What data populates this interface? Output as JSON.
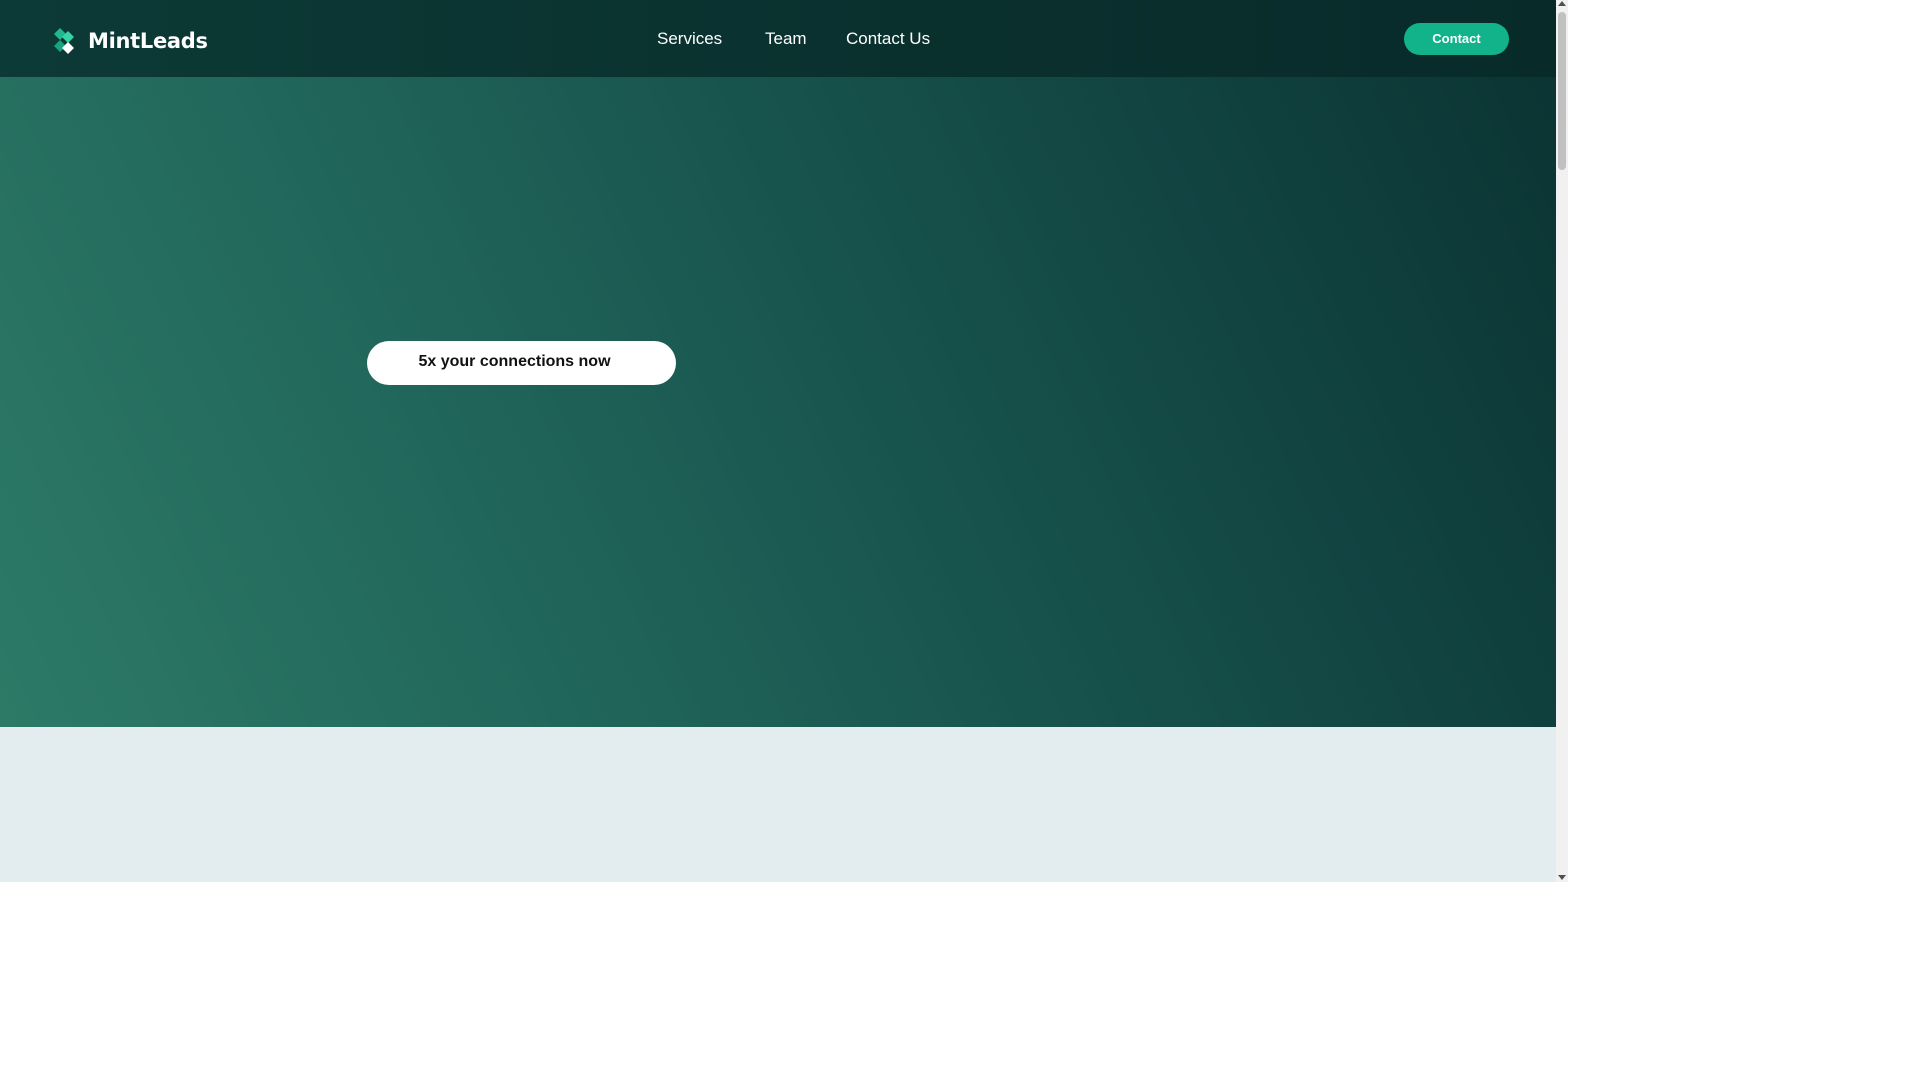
{
  "header": {
    "logo_text": "MintLeads",
    "nav": [
      {
        "label": "Services"
      },
      {
        "label": "Team"
      },
      {
        "label": "Contact Us"
      }
    ],
    "contact_button": "Contact"
  },
  "hero": {
    "cta_label": "5x your connections now"
  },
  "colors": {
    "header_bg": "#0b3432",
    "accent": "#12b38b",
    "hero_light": "#2d7a67",
    "hero_dark": "#0b3433",
    "section_bg": "#e3ecee"
  },
  "icons": {
    "logo": "mintleads-logo-icon"
  }
}
